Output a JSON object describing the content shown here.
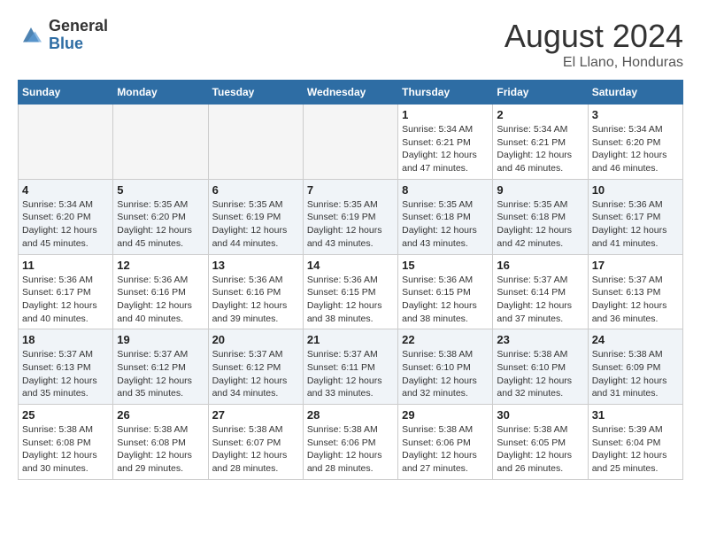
{
  "header": {
    "logo_general": "General",
    "logo_blue": "Blue",
    "month_title": "August 2024",
    "subtitle": "El Llano, Honduras"
  },
  "days_of_week": [
    "Sunday",
    "Monday",
    "Tuesday",
    "Wednesday",
    "Thursday",
    "Friday",
    "Saturday"
  ],
  "weeks": [
    [
      {
        "day": "",
        "info": ""
      },
      {
        "day": "",
        "info": ""
      },
      {
        "day": "",
        "info": ""
      },
      {
        "day": "",
        "info": ""
      },
      {
        "day": "1",
        "info": "Sunrise: 5:34 AM\nSunset: 6:21 PM\nDaylight: 12 hours and 47 minutes."
      },
      {
        "day": "2",
        "info": "Sunrise: 5:34 AM\nSunset: 6:21 PM\nDaylight: 12 hours and 46 minutes."
      },
      {
        "day": "3",
        "info": "Sunrise: 5:34 AM\nSunset: 6:20 PM\nDaylight: 12 hours and 46 minutes."
      }
    ],
    [
      {
        "day": "4",
        "info": "Sunrise: 5:34 AM\nSunset: 6:20 PM\nDaylight: 12 hours and 45 minutes."
      },
      {
        "day": "5",
        "info": "Sunrise: 5:35 AM\nSunset: 6:20 PM\nDaylight: 12 hours and 45 minutes."
      },
      {
        "day": "6",
        "info": "Sunrise: 5:35 AM\nSunset: 6:19 PM\nDaylight: 12 hours and 44 minutes."
      },
      {
        "day": "7",
        "info": "Sunrise: 5:35 AM\nSunset: 6:19 PM\nDaylight: 12 hours and 43 minutes."
      },
      {
        "day": "8",
        "info": "Sunrise: 5:35 AM\nSunset: 6:18 PM\nDaylight: 12 hours and 43 minutes."
      },
      {
        "day": "9",
        "info": "Sunrise: 5:35 AM\nSunset: 6:18 PM\nDaylight: 12 hours and 42 minutes."
      },
      {
        "day": "10",
        "info": "Sunrise: 5:36 AM\nSunset: 6:17 PM\nDaylight: 12 hours and 41 minutes."
      }
    ],
    [
      {
        "day": "11",
        "info": "Sunrise: 5:36 AM\nSunset: 6:17 PM\nDaylight: 12 hours and 40 minutes."
      },
      {
        "day": "12",
        "info": "Sunrise: 5:36 AM\nSunset: 6:16 PM\nDaylight: 12 hours and 40 minutes."
      },
      {
        "day": "13",
        "info": "Sunrise: 5:36 AM\nSunset: 6:16 PM\nDaylight: 12 hours and 39 minutes."
      },
      {
        "day": "14",
        "info": "Sunrise: 5:36 AM\nSunset: 6:15 PM\nDaylight: 12 hours and 38 minutes."
      },
      {
        "day": "15",
        "info": "Sunrise: 5:36 AM\nSunset: 6:15 PM\nDaylight: 12 hours and 38 minutes."
      },
      {
        "day": "16",
        "info": "Sunrise: 5:37 AM\nSunset: 6:14 PM\nDaylight: 12 hours and 37 minutes."
      },
      {
        "day": "17",
        "info": "Sunrise: 5:37 AM\nSunset: 6:13 PM\nDaylight: 12 hours and 36 minutes."
      }
    ],
    [
      {
        "day": "18",
        "info": "Sunrise: 5:37 AM\nSunset: 6:13 PM\nDaylight: 12 hours and 35 minutes."
      },
      {
        "day": "19",
        "info": "Sunrise: 5:37 AM\nSunset: 6:12 PM\nDaylight: 12 hours and 35 minutes."
      },
      {
        "day": "20",
        "info": "Sunrise: 5:37 AM\nSunset: 6:12 PM\nDaylight: 12 hours and 34 minutes."
      },
      {
        "day": "21",
        "info": "Sunrise: 5:37 AM\nSunset: 6:11 PM\nDaylight: 12 hours and 33 minutes."
      },
      {
        "day": "22",
        "info": "Sunrise: 5:38 AM\nSunset: 6:10 PM\nDaylight: 12 hours and 32 minutes."
      },
      {
        "day": "23",
        "info": "Sunrise: 5:38 AM\nSunset: 6:10 PM\nDaylight: 12 hours and 32 minutes."
      },
      {
        "day": "24",
        "info": "Sunrise: 5:38 AM\nSunset: 6:09 PM\nDaylight: 12 hours and 31 minutes."
      }
    ],
    [
      {
        "day": "25",
        "info": "Sunrise: 5:38 AM\nSunset: 6:08 PM\nDaylight: 12 hours and 30 minutes."
      },
      {
        "day": "26",
        "info": "Sunrise: 5:38 AM\nSunset: 6:08 PM\nDaylight: 12 hours and 29 minutes."
      },
      {
        "day": "27",
        "info": "Sunrise: 5:38 AM\nSunset: 6:07 PM\nDaylight: 12 hours and 28 minutes."
      },
      {
        "day": "28",
        "info": "Sunrise: 5:38 AM\nSunset: 6:06 PM\nDaylight: 12 hours and 28 minutes."
      },
      {
        "day": "29",
        "info": "Sunrise: 5:38 AM\nSunset: 6:06 PM\nDaylight: 12 hours and 27 minutes."
      },
      {
        "day": "30",
        "info": "Sunrise: 5:38 AM\nSunset: 6:05 PM\nDaylight: 12 hours and 26 minutes."
      },
      {
        "day": "31",
        "info": "Sunrise: 5:39 AM\nSunset: 6:04 PM\nDaylight: 12 hours and 25 minutes."
      }
    ]
  ]
}
